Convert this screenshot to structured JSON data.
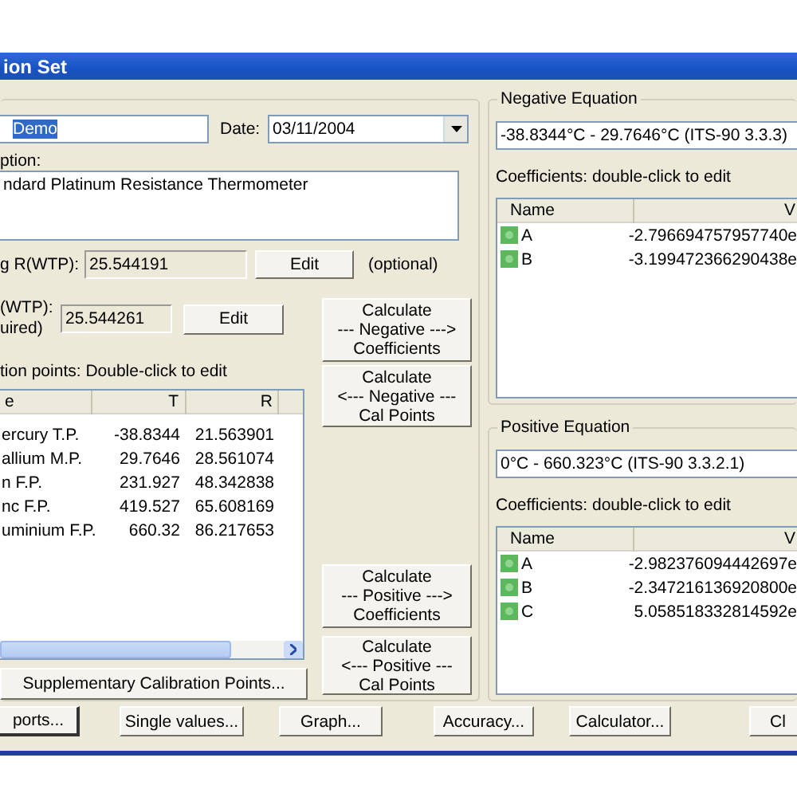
{
  "window": {
    "title": "ion Set"
  },
  "name_field": {
    "value": "Demo",
    "highlighted": true
  },
  "date": {
    "label": "Date:",
    "value": "03/11/2004"
  },
  "description": {
    "label": "ption:",
    "value": "ndard Platinum Resistance Thermometer"
  },
  "wtp_rows": [
    {
      "labels": [
        "g R(WTP):"
      ],
      "value": "25.544191",
      "button": "Edit",
      "note": "(optional)"
    },
    {
      "labels": [
        "(WTP):",
        "uired)"
      ],
      "value": "25.544261",
      "button": "Edit"
    }
  ],
  "points": {
    "label": "tion points: Double-click to edit",
    "columns": [
      "e",
      "T",
      "R"
    ],
    "rows": [
      [
        "ercury T.P.",
        "-38.8344",
        "21.563901"
      ],
      [
        "allium M.P.",
        "29.7646",
        "28.561074"
      ],
      [
        "n F.P.",
        "231.927",
        "48.342838"
      ],
      [
        "nc F.P.",
        "419.527",
        "65.608169"
      ],
      [
        "uminium F.P.",
        "660.32",
        "86.217653"
      ]
    ]
  },
  "supplementary_button": "Supplementary Calibration Points...",
  "calc_buttons": [
    {
      "label": "Calculate\n--- Negative --->\nCoefficients"
    },
    {
      "label": "Calculate\n<--- Negative ---\nCal Points"
    },
    {
      "label": "Calculate\n--- Positive --->\nCoefficients"
    },
    {
      "label": "Calculate\n<--- Positive ---\nCal Points"
    }
  ],
  "equations": [
    {
      "title": "Negative Equation",
      "range": "-38.8344°C - 29.7646°C (ITS-90 3.3.3)",
      "coefficients_label": "Coefficients: double-click to edit",
      "columns": [
        "Name",
        "V"
      ],
      "rows": [
        {
          "name": "A",
          "value": "-2.796694757957740e"
        },
        {
          "name": "B",
          "value": "-3.199472366290438e"
        }
      ]
    },
    {
      "title": "Positive Equation",
      "range": "0°C - 660.323°C (ITS-90 3.3.2.1)",
      "coefficients_label": "Coefficients: double-click to edit",
      "columns": [
        "Name",
        "V"
      ],
      "rows": [
        {
          "name": "A",
          "value": "-2.982376094442697e"
        },
        {
          "name": "B",
          "value": "-2.347216136920800e"
        },
        {
          "name": "C",
          "value": "5.058518332814592e"
        }
      ]
    }
  ],
  "buttons": [
    {
      "label": "ports...",
      "default": true
    },
    {
      "label": "Single values...",
      "default": false
    },
    {
      "label": "Graph...",
      "default": false
    },
    {
      "label": "Accuracy...",
      "default": false
    },
    {
      "label": "Calculator...",
      "default": false
    },
    {
      "label": "Cl",
      "default": false
    }
  ]
}
